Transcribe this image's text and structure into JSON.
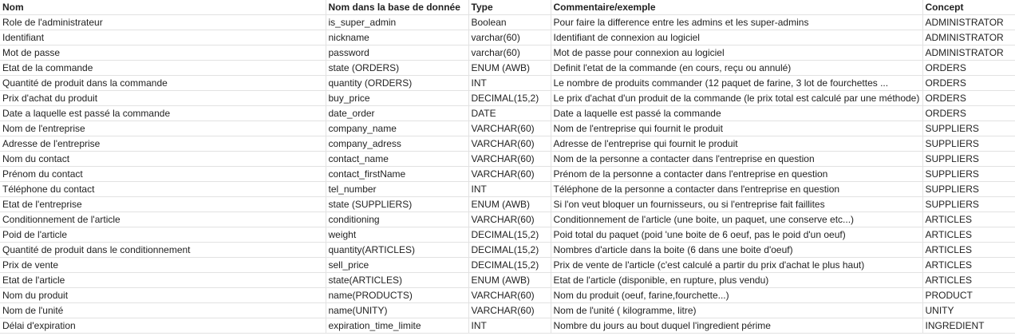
{
  "table": {
    "headers": [
      "Nom",
      "Nom dans la base de donnée",
      "Type",
      "Commentaire/exemple",
      "Concept"
    ],
    "rows": [
      [
        "Role de l'administrateur",
        "is_super_admin",
        "Boolean",
        "Pour faire la difference entre les admins et les super-admins",
        "ADMINISTRATOR"
      ],
      [
        "Identifiant",
        "nickname",
        "varchar(60)",
        "Identifiant de connexion au logiciel",
        "ADMINISTRATOR"
      ],
      [
        "Mot de passe",
        "password",
        "varchar(60)",
        "Mot de passe pour connexion au logiciel",
        "ADMINISTRATOR"
      ],
      [
        "Etat de la commande",
        "state (ORDERS)",
        "ENUM (AWB)",
        "Definit l'etat de la commande (en cours, reçu ou annulé)",
        "ORDERS"
      ],
      [
        "Quantité de produit dans la commande",
        "quantity (ORDERS)",
        "INT",
        "Le nombre de produits commander (12 paquet de farine, 3 lot de fourchettes ...",
        "ORDERS"
      ],
      [
        "Prix d'achat du produit",
        "buy_price",
        "DECIMAL(15,2)",
        "Le prix d'achat d'un produit de la commande (le prix total est calculé par une méthode)",
        "ORDERS"
      ],
      [
        "Date a laquelle est passé la commande",
        "date_order",
        "DATE",
        "Date a laquelle est passé la commande",
        "ORDERS"
      ],
      [
        "Nom de l'entreprise",
        "company_name",
        "VARCHAR(60)",
        "Nom de l'entreprise qui fournit le produit",
        "SUPPLIERS"
      ],
      [
        "Adresse de l'entreprise",
        "company_adress",
        "VARCHAR(60)",
        "Adresse de l'entreprise qui fournit le produit",
        "SUPPLIERS"
      ],
      [
        "Nom du contact",
        "contact_name",
        "VARCHAR(60)",
        "Nom de la personne a contacter dans l'entreprise en question",
        "SUPPLIERS"
      ],
      [
        "Prénom du contact",
        "contact_firstName",
        "VARCHAR(60)",
        "Prénom de la personne a contacter dans l'entreprise en question",
        "SUPPLIERS"
      ],
      [
        "Téléphone du contact",
        "tel_number",
        "INT",
        "Téléphone de la personne a contacter dans l'entreprise en question",
        "SUPPLIERS"
      ],
      [
        "Etat de l'entreprise",
        "state (SUPPLIERS)",
        "ENUM (AWB)",
        "Si l'on veut bloquer un fournisseurs, ou si l'entreprise fait faillites",
        "SUPPLIERS"
      ],
      [
        "Conditionnement de l'article",
        "conditioning",
        "VARCHAR(60)",
        "Conditionnement de l'article (une boite, un paquet, une conserve etc...)",
        "ARTICLES"
      ],
      [
        "Poid de l'article",
        "weight",
        "DECIMAL(15,2)",
        "Poid total du paquet (poid 'une boite de 6 oeuf, pas le poid d'un oeuf)",
        "ARTICLES"
      ],
      [
        "Quantité de produit dans le conditionnement",
        "quantity(ARTICLES)",
        "DECIMAL(15,2)",
        "Nombres d'article dans la boite (6 dans une boite d'oeuf)",
        "ARTICLES"
      ],
      [
        "Prix de vente",
        "sell_price",
        "DECIMAL(15,2)",
        "Prix de vente de l'article (c'est calculé a partir du prix d'achat le plus haut)",
        "ARTICLES"
      ],
      [
        "Etat de l'article",
        "state(ARTICLES)",
        "ENUM (AWB)",
        "Etat de l'article (disponible, en rupture, plus vendu)",
        "ARTICLES"
      ],
      [
        "Nom du produit",
        "name(PRODUCTS)",
        "VARCHAR(60)",
        "Nom du produit (oeuf, farine,fourchette...)",
        "PRODUCT"
      ],
      [
        "Nom de l'unité",
        "name(UNITY)",
        "VARCHAR(60)",
        "Nom de l'unité ( kilogramme, litre)",
        "UNITY"
      ],
      [
        "Délai d'expiration",
        "expiration_time_limite",
        "INT",
        "Nombre du jours au bout duquel l'ingredient périme",
        "INGREDIENT"
      ]
    ]
  }
}
